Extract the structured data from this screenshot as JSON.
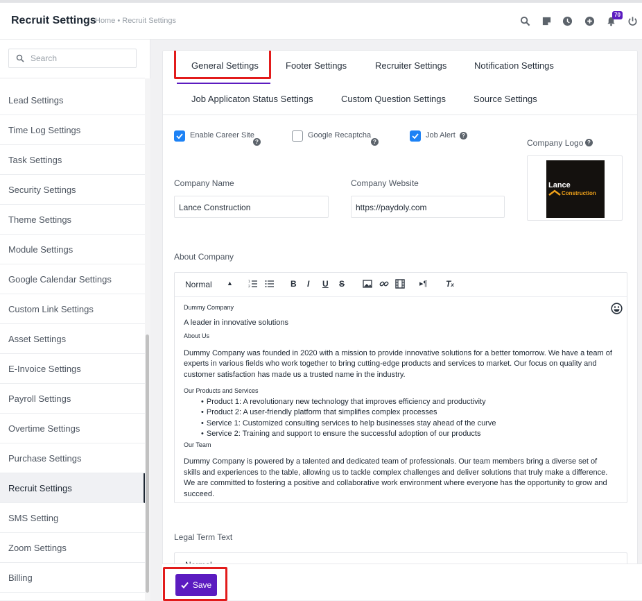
{
  "header": {
    "title": "Recruit Settings",
    "breadcrumb": "Home • Recruit Settings",
    "notification_count": "70",
    "icons": [
      "search-icon",
      "sticky-note-icon",
      "clock-icon",
      "plus-circle-icon",
      "bell-icon",
      "power-icon"
    ]
  },
  "sidebar": {
    "search_placeholder": "Search",
    "items": [
      {
        "label": "Lead Settings"
      },
      {
        "label": "Time Log Settings"
      },
      {
        "label": "Task Settings"
      },
      {
        "label": "Security Settings"
      },
      {
        "label": "Theme Settings"
      },
      {
        "label": "Module Settings"
      },
      {
        "label": "Google Calendar Settings"
      },
      {
        "label": "Custom Link Settings"
      },
      {
        "label": "Asset Settings"
      },
      {
        "label": "E-Invoice Settings"
      },
      {
        "label": "Payroll Settings"
      },
      {
        "label": "Overtime Settings"
      },
      {
        "label": "Purchase Settings"
      },
      {
        "label": "Recruit Settings",
        "active": true
      },
      {
        "label": "SMS Setting"
      },
      {
        "label": "Zoom Settings"
      },
      {
        "label": "Billing"
      }
    ]
  },
  "tabs": [
    {
      "label": "General Settings",
      "active": true
    },
    {
      "label": "Footer Settings"
    },
    {
      "label": "Recruiter Settings"
    },
    {
      "label": "Notification Settings"
    },
    {
      "label": "Job Applicaton Status Settings"
    },
    {
      "label": "Custom Question Settings"
    },
    {
      "label": "Source Settings"
    }
  ],
  "form": {
    "enable_career_site": {
      "label": "Enable Career Site",
      "checked": true
    },
    "google_recaptcha": {
      "label": "Google Recaptcha",
      "checked": false
    },
    "job_alert": {
      "label": "Job Alert",
      "checked": true
    },
    "company_logo_label": "Company Logo",
    "company_logo": {
      "line1": "Lance",
      "line2": "Construction"
    },
    "company_name": {
      "label": "Company Name",
      "value": "Lance Construction"
    },
    "company_website": {
      "label": "Company Website",
      "value": "https://paydoly.com"
    },
    "about_label": "About Company",
    "legal_label": "Legal Term Text"
  },
  "editor": {
    "format_select": "Normal",
    "content": {
      "h1": "Dummy Company",
      "tagline": "A leader in innovative solutions",
      "h2": "About Us",
      "about": "Dummy Company was founded in 2020 with a mission to provide innovative solutions for a better tomorrow. We have a team of experts in various fields who work together to bring cutting-edge products and services to market. Our focus on quality and customer satisfaction has made us a trusted name in the industry.",
      "h3": "Our Products and Services",
      "products": [
        "Product 1: A revolutionary new technology that improves efficiency and productivity",
        "Product 2: A user-friendly platform that simplifies complex processes",
        "Service 1: Customized consulting services to help businesses stay ahead of the curve",
        "Service 2: Training and support to ensure the successful adoption of our products"
      ],
      "h4": "Our Team",
      "team": "Dummy Company is powered by a talented and dedicated team of professionals. Our team members bring a diverse set of skills and experiences to the table, allowing us to tackle complex challenges and deliver solutions that truly make a difference. We are committed to fostering a positive and collaborative work environment where everyone has the opportunity to grow and succeed."
    }
  },
  "footer": {
    "save_label": "Save"
  },
  "colors": {
    "accent": "#5b1bc0",
    "highlight": "#e21b1b",
    "checkbox": "#1d82f5"
  }
}
